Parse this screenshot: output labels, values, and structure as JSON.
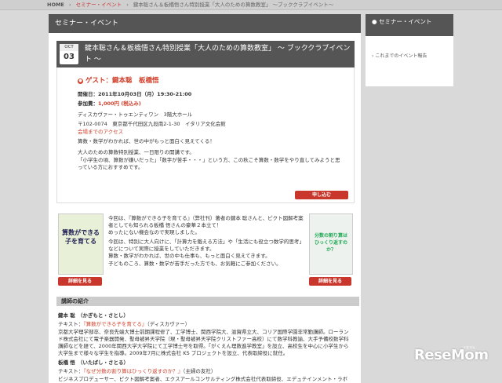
{
  "breadcrumb": {
    "home": "HOME",
    "sep1": "›",
    "category": "セミナー・イベント",
    "sep2": "›",
    "current": "鍵本聡さん＆板橋悟さん特別授業「大人のための算数教室」 ～ブッククラブイベント～"
  },
  "main": {
    "header": "セミナー・イベント",
    "event": {
      "month": "OCT",
      "day": "03",
      "title": "鍵本聡さん＆板橋悟さん特別授業「大人のための算数教室」 ～ ブッククラブイベント ～",
      "guest_label": "ゲスト：",
      "guest_names": "鍵本聡　板橋悟",
      "date_label": "開催日：",
      "date_value": "2011年10月03日（月）19:30-21:00",
      "fee_label": "参加費：",
      "fee_value": "1,000円 (税込み)",
      "venue": "ディスカヴァー・トゥエンティワン　3階大ホール",
      "address": "〒102-0074　東京都千代田区九段南2-1-30　イタリア文化会館",
      "access_link": "会場までのアクセス",
      "lead": "算数・数学がわかれば、世の中がもっと面白く見えてくる！",
      "body1": "大人のための算数特別授業、一日限りの開講です。",
      "body2": "「小学生の頃、算数が嫌いだった」「数字が苦手・・・」という方、この秋こそ算数・数学をやり直してみようと思っている方におすすめです。",
      "apply_button": "申し込む"
    },
    "books": {
      "book1_cover": "算数ができる子を育てる",
      "book2_cover": "分数の割り算はひっくり返すのか？",
      "detail_button_1": "詳細を見る",
      "detail_button_2": "詳細を見る",
      "desc1": "今回は、『算数ができる子を育てる』（弊社刊）著者の鍵本 聡さんと、ピクト図解考案者としても知られる板橋 悟さんの豪華２本立て！",
      "desc2": "めったにない機会なので実現しました。",
      "desc3": "今回は、特別に大人向けに、「計算力を鍛える方法」や「生活にも役立つ数学的思考」などについて実際に授業をしていただきます。",
      "desc4": "算数・数学がわかれば、世の中も仕事も、もっと面白く見えてきます。",
      "desc5": "子どものころ、算数・数学が苦手だった方でも、お気軽にご参加ください。"
    },
    "speakers": {
      "section_title": "講師の紹介",
      "s1_name": "鍵本 聡　（かぎもと・さとし）",
      "s1_text_label": "テキスト：",
      "s1_text_title": "『算数ができる子を育てる』",
      "s1_text_pub": "（ディスカヴァー）",
      "s1_bio": "京都大学理学部卒、奈良先端大博士前期課程修了、工学博士、関西学院大、滋賀県立大、コリア国際学園非常勤講師。ローランド株式会社にて電子楽器開発、聖母被昇天学院（現・聖母被昇天学院クリストファー高校）にて数学科教諭、大手予備校数学科講師などを経て、2000年関西大学大学院にて工学博士号を取得。「がくえん理数進学教室」を設立、高校生を中心に小学生から大学生まで様々な学生を指導。2009年7月に株式会社 KS プロジェクトを設立、代表取締役に就任。",
      "s2_name": "板橋 悟　（いたばし・さとる）",
      "s2_text_label": "テキスト：",
      "s2_text_title": "『なぜ分数の割り算はひっくり返すのか？』",
      "s2_text_pub": "（主婦の友社）",
      "s2_bio": "ビジネスプロデューサー、ピクト図解考案者、エクスアールコンサルティング株式会社代表取締役、エデュテインメント・ラボ"
    }
  },
  "sidebar": {
    "header": "セミナー・イベント",
    "link": "これまでのイベント報告"
  },
  "logo": {
    "text": "ReseMom",
    "tagline": "リセマム"
  }
}
